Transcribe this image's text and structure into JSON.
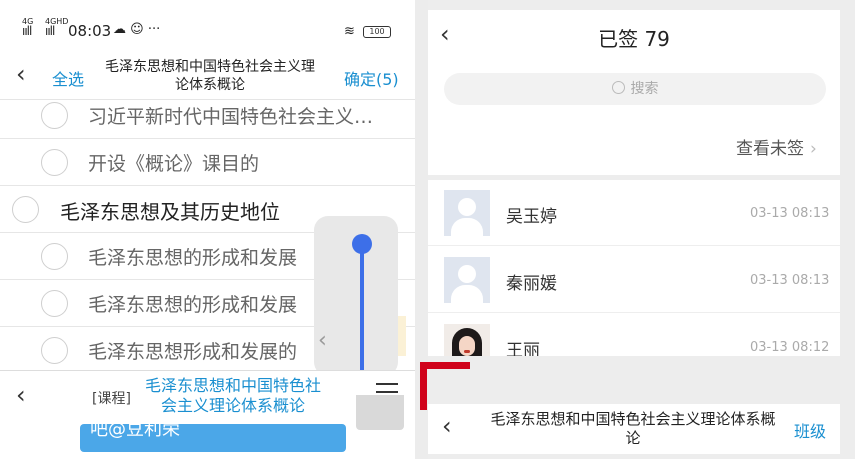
{
  "status_bar": {
    "signal1_label": "4G",
    "signal2_label": "4GHD",
    "time": "08:03",
    "icons_text": "☁ ☺ ···",
    "wifi_icon": "wifi-icon",
    "battery": "100"
  },
  "left_header": {
    "back": "‹",
    "select_all": "全选",
    "title": "毛泽东思想和中国特色社会主义理论体系概论",
    "confirm": "确定(5)"
  },
  "chapter_list": [
    {
      "label": "习近平新时代中国特色社会主义…",
      "level": "sub"
    },
    {
      "label": "开设《概论》课目的",
      "level": "sub"
    },
    {
      "label": "毛泽东思想及其历史地位",
      "level": "main"
    },
    {
      "label": "毛泽东思想的形成和发展",
      "level": "sub"
    },
    {
      "label": "毛泽东思想的形成和发展",
      "level": "sub"
    },
    {
      "label": "毛泽东思想形成和发展的",
      "level": "sub"
    }
  ],
  "left_bottom_bar": {
    "back": "‹",
    "tag": "[课程]",
    "course_title": "毛泽东思想和中国特色社会主义理论体系概论"
  },
  "left_overlay_button": {
    "text": "吧@豆利荣"
  },
  "right_header": {
    "back": "‹",
    "title": "已签 79"
  },
  "search": {
    "placeholder": "搜索"
  },
  "view_unsigned": {
    "label": "查看未签",
    "chevron": "›"
  },
  "attendees": [
    {
      "name": "吴玉婷",
      "time": "03-13 08:13",
      "avatar": "default"
    },
    {
      "name": "秦丽媛",
      "time": "03-13 08:13",
      "avatar": "default"
    },
    {
      "name": "王丽",
      "time": "03-13 08:12",
      "avatar": "photo"
    }
  ],
  "right_bottom_bar": {
    "back": "‹",
    "title": "毛泽东思想和中国特色社会主义理论体系概论",
    "class_button": "班级"
  },
  "colors": {
    "accent_blue": "#1a8fd0",
    "slider_blue": "#3d6fe8",
    "highlight_red": "#d0021b"
  }
}
